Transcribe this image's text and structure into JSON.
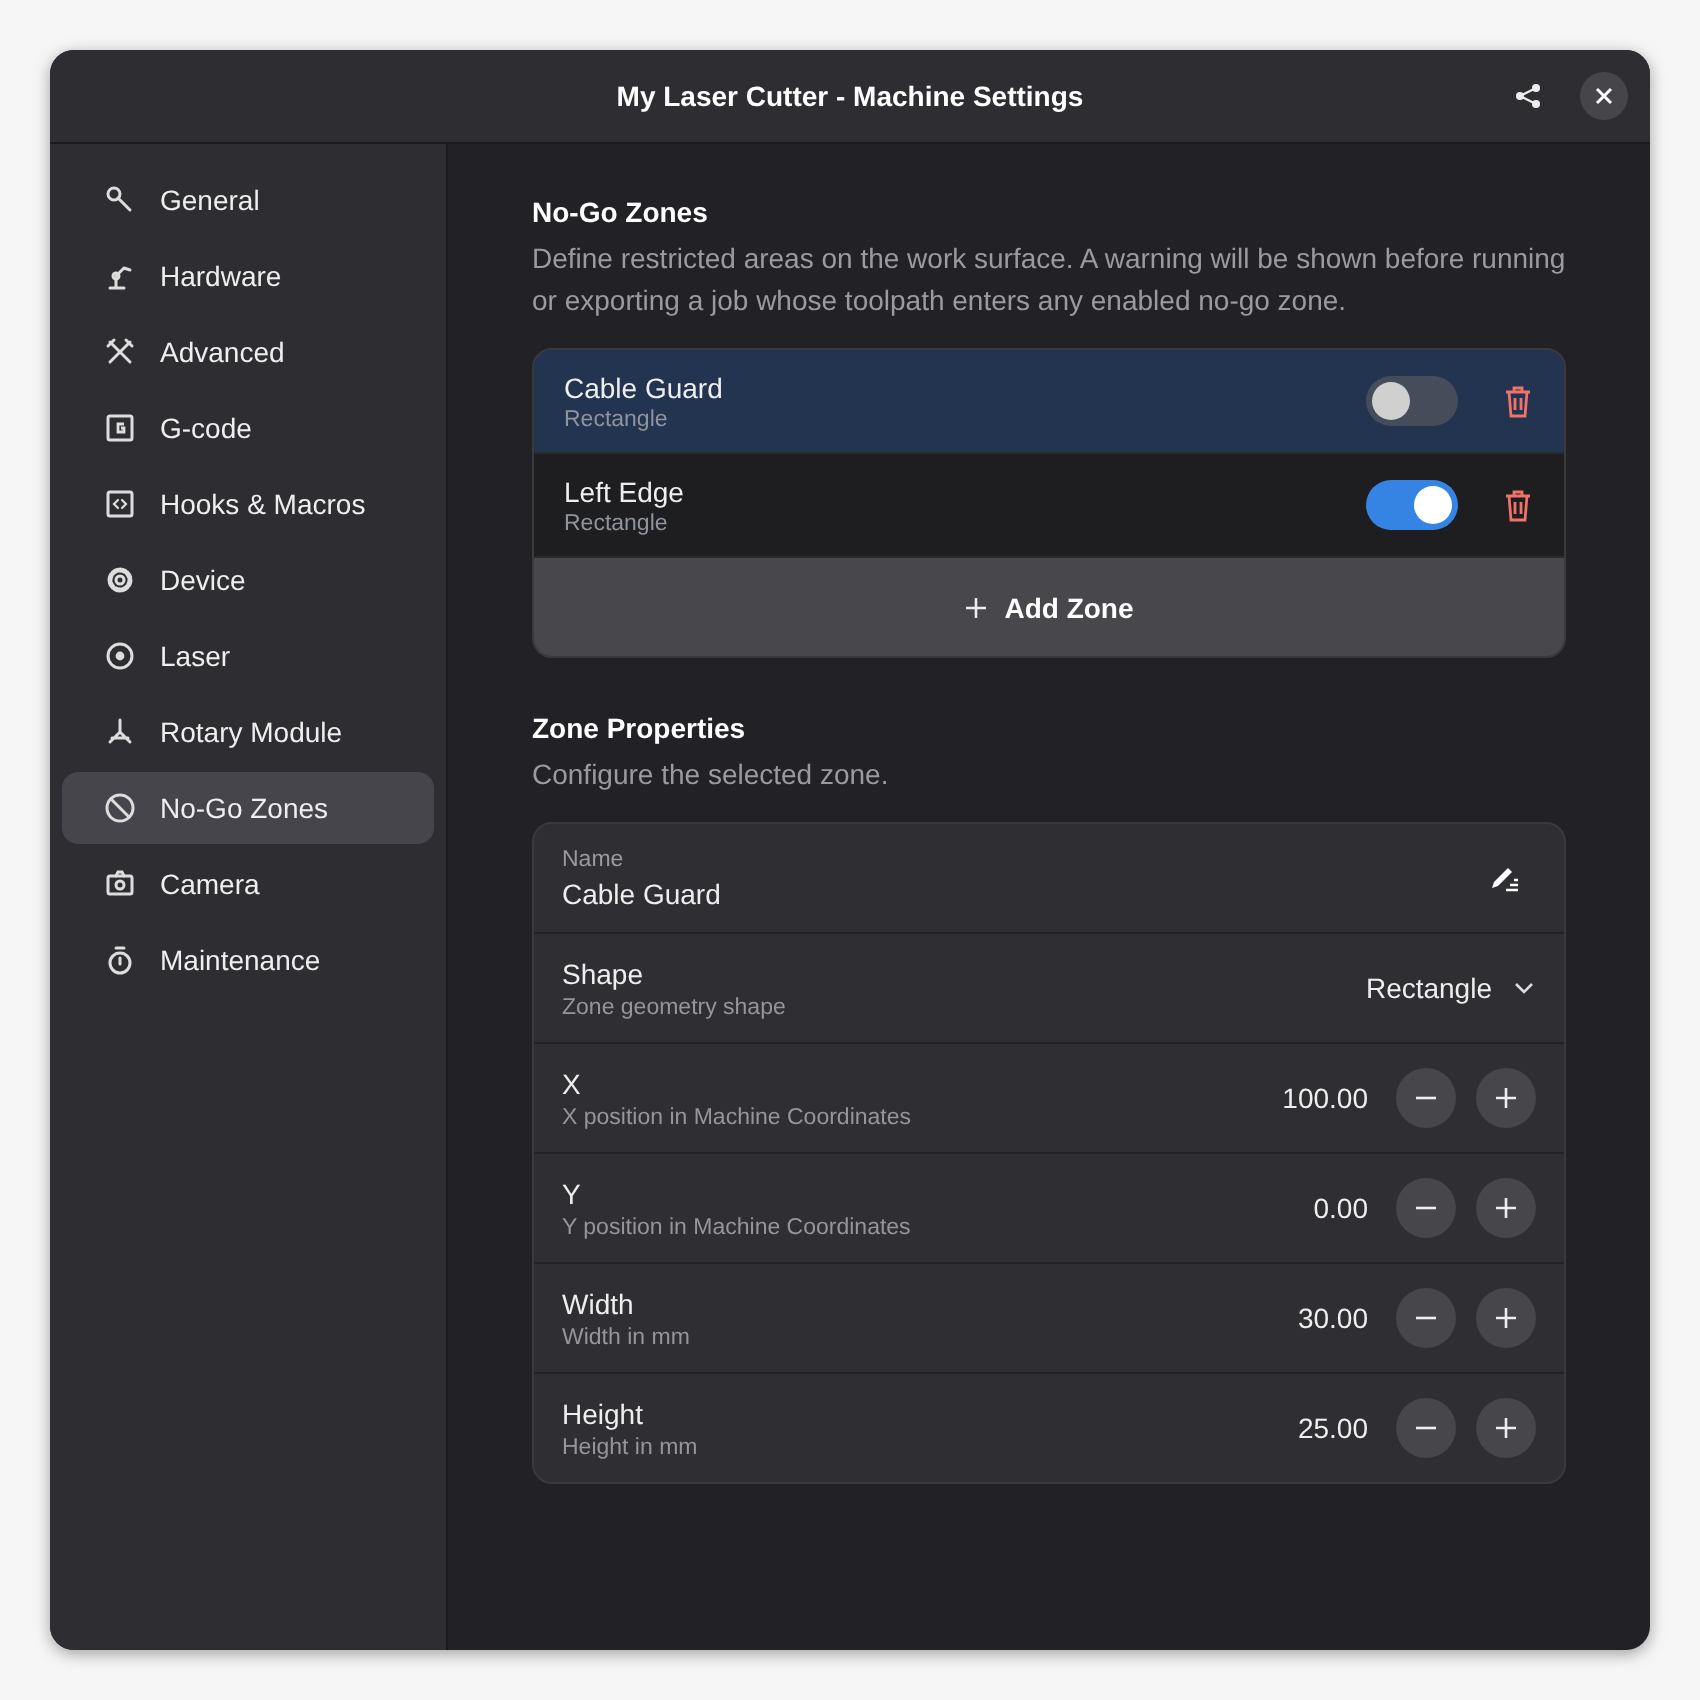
{
  "window": {
    "title": "My Laser Cutter - Machine Settings"
  },
  "sidebar": {
    "items": [
      {
        "label": "General",
        "selected": false
      },
      {
        "label": "Hardware",
        "selected": false
      },
      {
        "label": "Advanced",
        "selected": false
      },
      {
        "label": "G-code",
        "selected": false
      },
      {
        "label": "Hooks & Macros",
        "selected": false
      },
      {
        "label": "Device",
        "selected": false
      },
      {
        "label": "Laser",
        "selected": false
      },
      {
        "label": "Rotary Module",
        "selected": false
      },
      {
        "label": "No-Go Zones",
        "selected": true
      },
      {
        "label": "Camera",
        "selected": false
      },
      {
        "label": "Maintenance",
        "selected": false
      }
    ]
  },
  "zones_section": {
    "title": "No-Go Zones",
    "description": "Define restricted areas on the work surface. A warning will be shown before running or exporting a job whose toolpath enters any enabled no-go zone.",
    "zones": [
      {
        "name": "Cable Guard",
        "shape": "Rectangle",
        "selected": true,
        "on": false
      },
      {
        "name": "Left Edge",
        "shape": "Rectangle",
        "selected": false,
        "on": true
      }
    ],
    "add_button": "Add Zone"
  },
  "properties_section": {
    "title": "Zone Properties",
    "description": "Configure the selected zone.",
    "rows": [
      {
        "kind": "entry",
        "label": "Name",
        "value": "Cable Guard"
      },
      {
        "kind": "dropdown",
        "label": "Shape",
        "subtitle": "Zone geometry shape",
        "value": "Rectangle"
      },
      {
        "kind": "spin",
        "label": "X",
        "subtitle": "X position in Machine Coordinates",
        "value": "100.00"
      },
      {
        "kind": "spin",
        "label": "Y",
        "subtitle": "Y position in Machine Coordinates",
        "value": "0.00"
      },
      {
        "kind": "spin",
        "label": "Width",
        "subtitle": "Width in mm",
        "value": "30.00"
      },
      {
        "kind": "spin",
        "label": "Height",
        "subtitle": "Height in mm",
        "value": "25.00"
      }
    ]
  }
}
